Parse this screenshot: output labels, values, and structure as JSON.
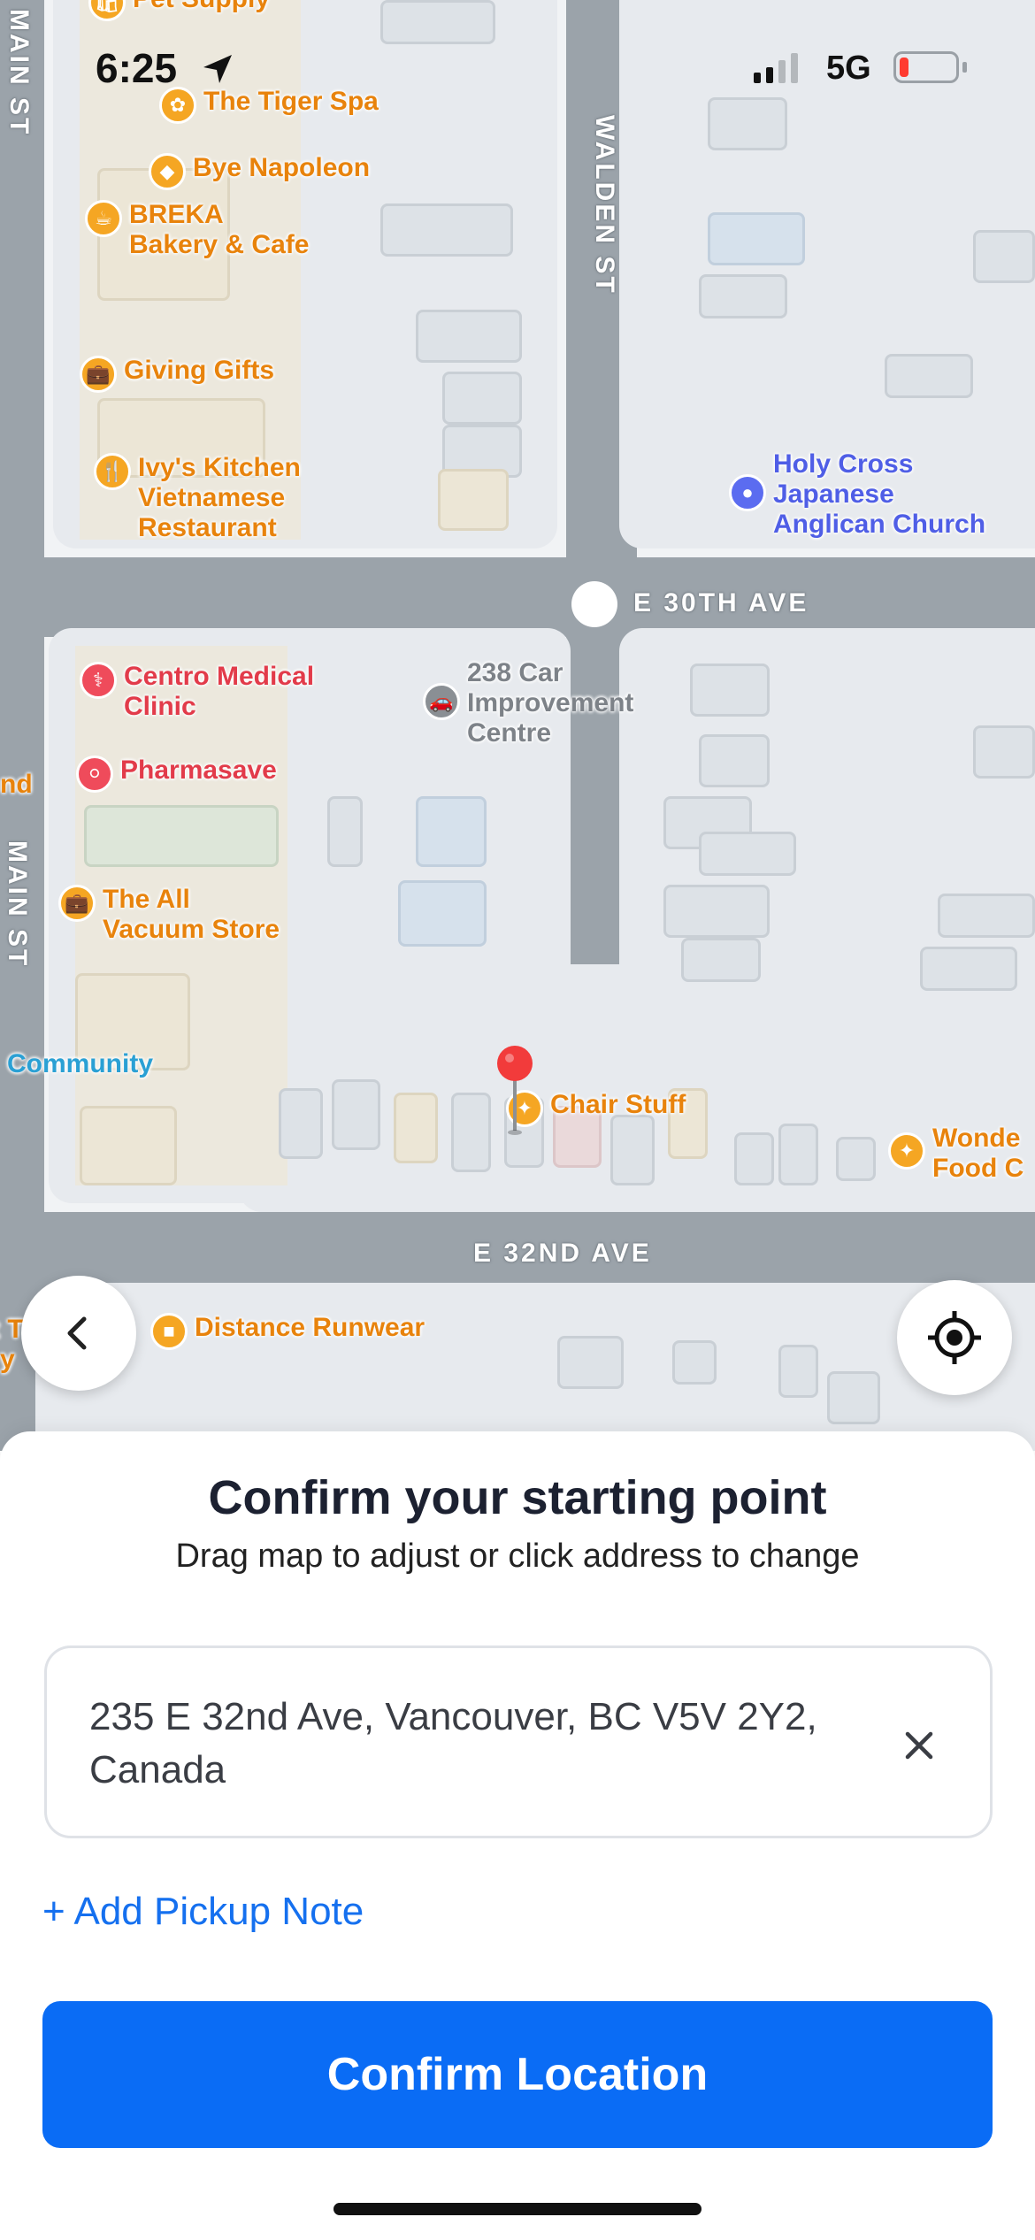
{
  "status_bar": {
    "time": "6:25",
    "network": "5G",
    "battery_color": "#ff3b30"
  },
  "map": {
    "streets": {
      "main_st_top": "MAIN ST",
      "walden_st": "WALDEN ST",
      "e_30th_ave": "E 30TH AVE",
      "main_st_mid": "MAIN ST",
      "e_32nd_ave": "E 32ND AVE"
    },
    "pois": {
      "pet_supply": "Pet Supply",
      "tiger_spa": "The Tiger Spa",
      "bye_napoleon": "Bye Napoleon",
      "breka": [
        "BREKA",
        "Bakery & Cafe"
      ],
      "giving_gifts": "Giving Gifts",
      "ivys_kitchen": [
        "Ivy's Kitchen",
        "Vietnamese",
        "Restaurant"
      ],
      "holy_cross": [
        "Holy Cross",
        "Japanese",
        "Anglican Church"
      ],
      "centro_medical": [
        "Centro Medical",
        "Clinic"
      ],
      "car_improvement": [
        "238 Car",
        "Improvement",
        "Centre"
      ],
      "pharmasave": "Pharmasave",
      "all_vacuum": [
        "The All",
        "Vacuum Store"
      ],
      "community": "Community",
      "chair_stuff": "Chair Stuff",
      "wonder_food": [
        "Wonde",
        "Food C"
      ],
      "distance_runwear": "Distance Runwear",
      "edge_nd": "nd",
      "edge_t": "t T",
      "edge_y": "y"
    },
    "icons": {
      "back": "chevron-left-icon",
      "locate": "crosshair-icon",
      "pin": "map-pin-icon"
    }
  },
  "sheet": {
    "title": "Confirm your starting point",
    "subtitle": "Drag map to adjust or click address to change",
    "address": "235 E 32nd Ave, Vancouver, BC V5V 2Y2, Canada",
    "add_note": "+ Add Pickup Note",
    "confirm": "Confirm Location",
    "accent_color": "#0a6cf5"
  }
}
